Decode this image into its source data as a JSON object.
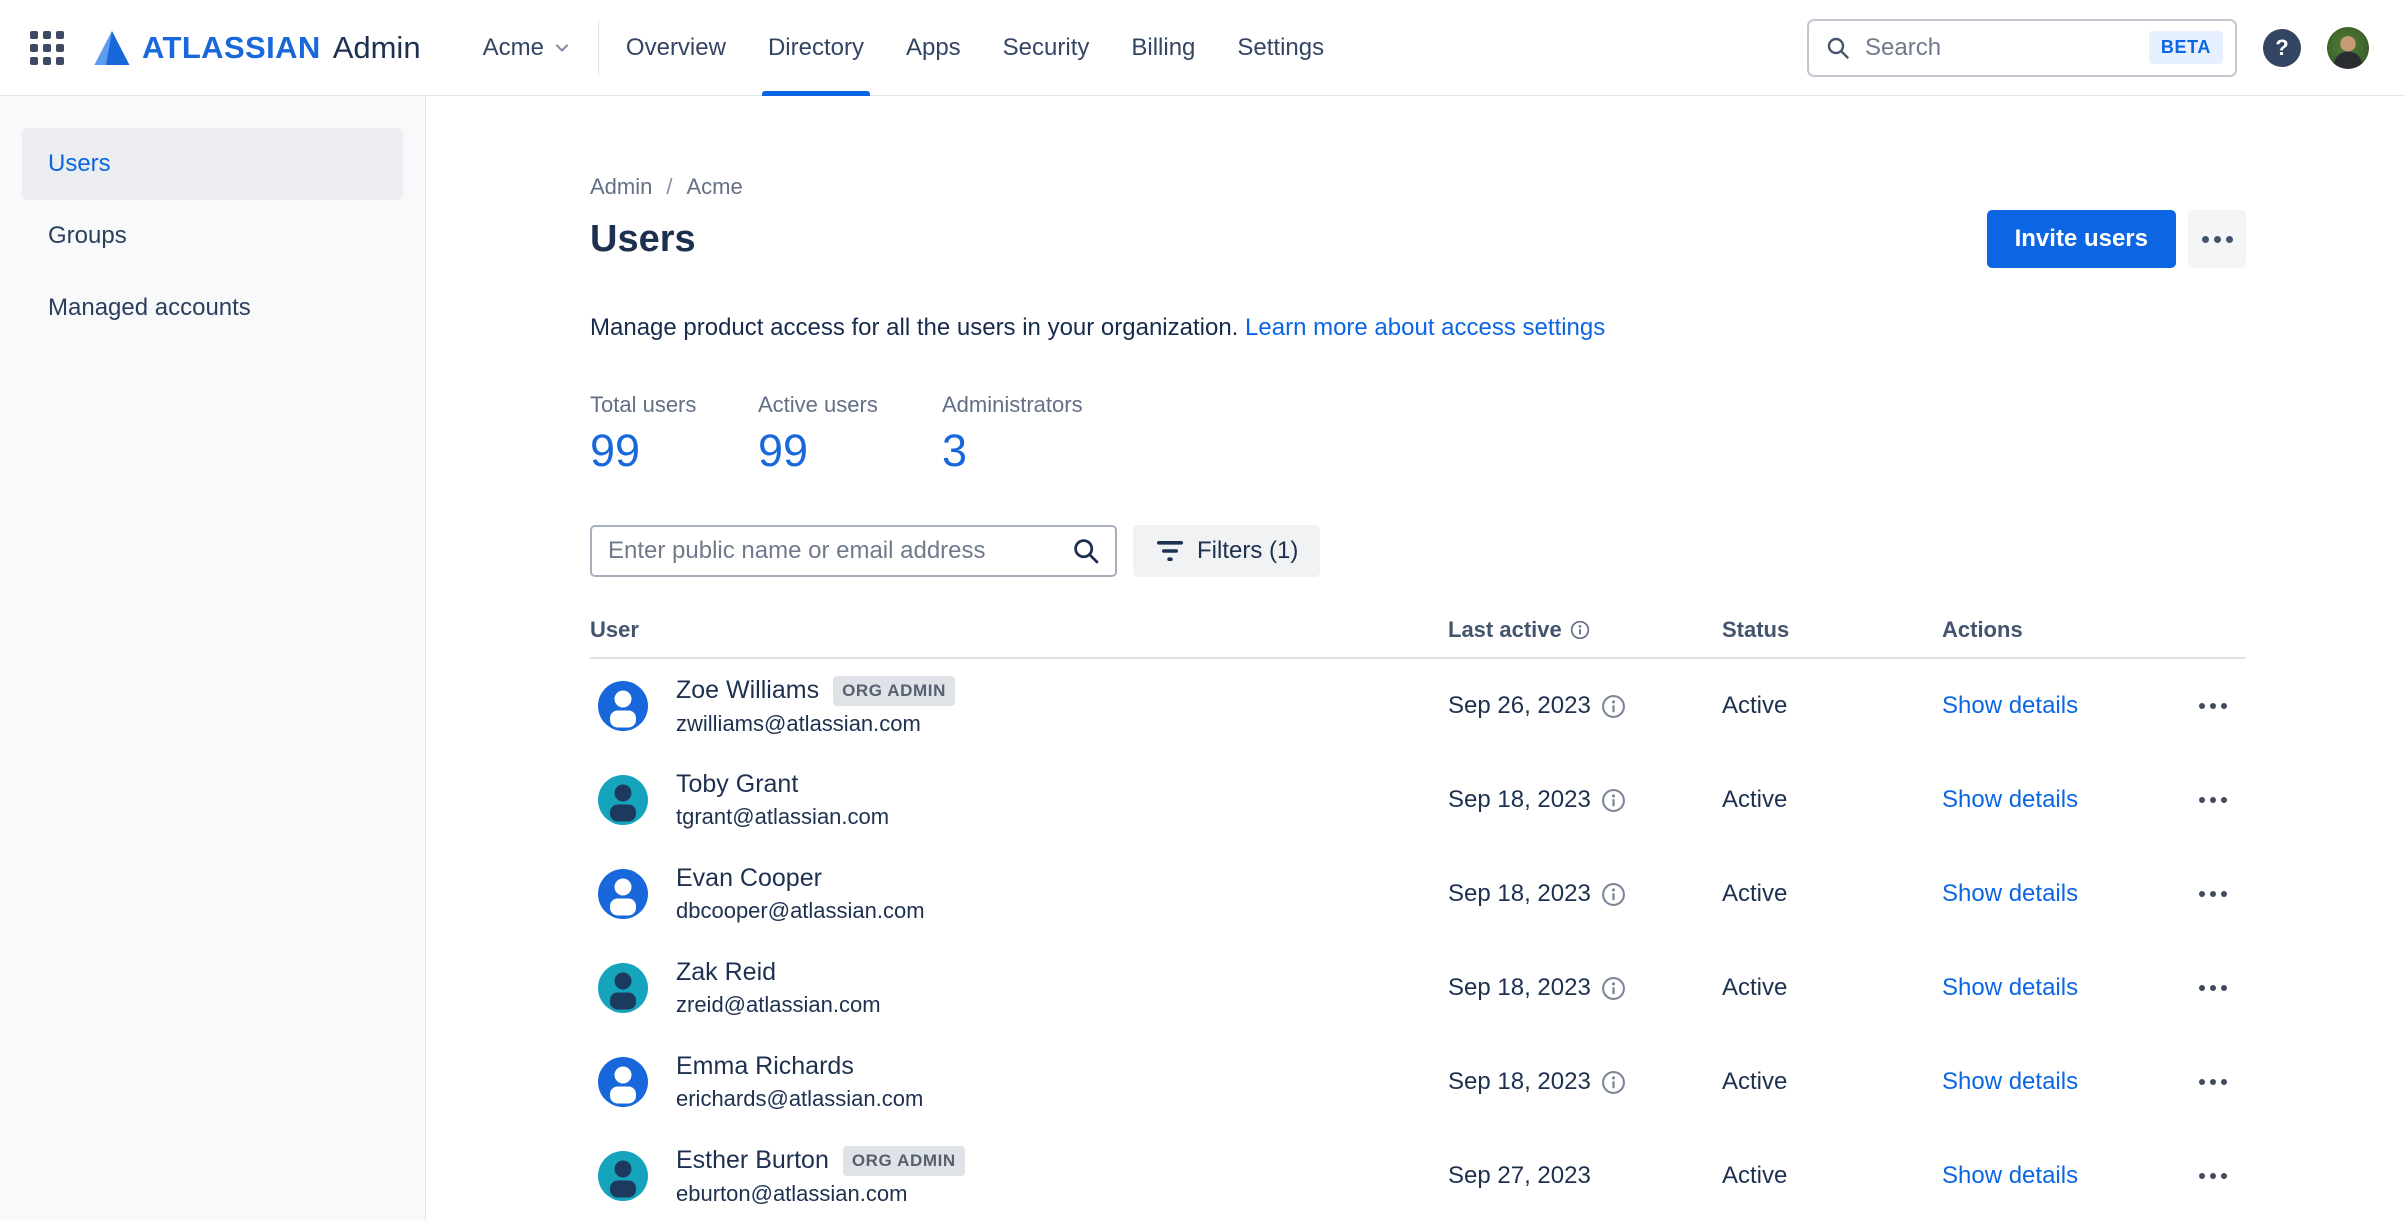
{
  "colors": {
    "accent_blue": "#0C66E4",
    "brand_blue": "#1868DB",
    "text_navy": "#1E3050",
    "text_gray": "#626F86",
    "avatar_blue": "#1868DB",
    "avatar_teal": "#16A3BC",
    "badge_bg": "#DFE2E7"
  },
  "header": {
    "brand": {
      "wordmark": "ATLASSIAN",
      "product": "Admin"
    },
    "org_switcher": {
      "label": "Acme"
    },
    "tabs": [
      {
        "label": "Overview",
        "active": false
      },
      {
        "label": "Directory",
        "active": true
      },
      {
        "label": "Apps",
        "active": false
      },
      {
        "label": "Security",
        "active": false
      },
      {
        "label": "Billing",
        "active": false
      },
      {
        "label": "Settings",
        "active": false
      }
    ],
    "search": {
      "placeholder": "Search",
      "beta_badge": "BETA"
    },
    "help": {
      "glyph": "?"
    }
  },
  "sidebar": {
    "items": [
      {
        "label": "Users",
        "active": true
      },
      {
        "label": "Groups",
        "active": false
      },
      {
        "label": "Managed accounts",
        "active": false
      }
    ]
  },
  "main": {
    "breadcrumb": {
      "items": [
        "Admin",
        "Acme"
      ],
      "separator": "/"
    },
    "page_title": "Users",
    "actions": {
      "invite_label": "Invite users"
    },
    "description": {
      "text": "Manage product access for all the users in your organization. ",
      "link": "Learn more about access settings"
    },
    "stats": [
      {
        "label": "Total users",
        "value": "99"
      },
      {
        "label": "Active users",
        "value": "99"
      },
      {
        "label": "Administrators",
        "value": "3"
      }
    ],
    "toolbar": {
      "search_placeholder": "Enter public name or email address",
      "filters_label": "Filters (1)"
    },
    "table": {
      "columns": {
        "user": "User",
        "last_active": "Last active",
        "status": "Status",
        "actions": "Actions"
      },
      "rows": [
        {
          "name": "Zoe Williams",
          "email": "zwilliams@atlassian.com",
          "badge": "ORG ADMIN",
          "avatar_color": "blue",
          "last_active": "Sep 26, 2023",
          "last_active_info": true,
          "status": "Active",
          "action": "Show details"
        },
        {
          "name": "Toby Grant",
          "email": "tgrant@atlassian.com",
          "badge": null,
          "avatar_color": "teal",
          "last_active": "Sep 18, 2023",
          "last_active_info": true,
          "status": "Active",
          "action": "Show details"
        },
        {
          "name": "Evan Cooper",
          "email": "dbcooper@atlassian.com",
          "badge": null,
          "avatar_color": "blue",
          "last_active": "Sep 18, 2023",
          "last_active_info": true,
          "status": "Active",
          "action": "Show details"
        },
        {
          "name": "Zak Reid",
          "email": "zreid@atlassian.com",
          "badge": null,
          "avatar_color": "teal",
          "last_active": "Sep 18, 2023",
          "last_active_info": true,
          "status": "Active",
          "action": "Show details"
        },
        {
          "name": "Emma Richards",
          "email": "erichards@atlassian.com",
          "badge": null,
          "avatar_color": "blue",
          "last_active": "Sep 18, 2023",
          "last_active_info": true,
          "status": "Active",
          "action": "Show details"
        },
        {
          "name": "Esther Burton",
          "email": "eburton@atlassian.com",
          "badge": "ORG ADMIN",
          "avatar_color": "teal",
          "last_active": "Sep 27, 2023",
          "last_active_info": false,
          "status": "Active",
          "action": "Show details"
        }
      ]
    }
  }
}
